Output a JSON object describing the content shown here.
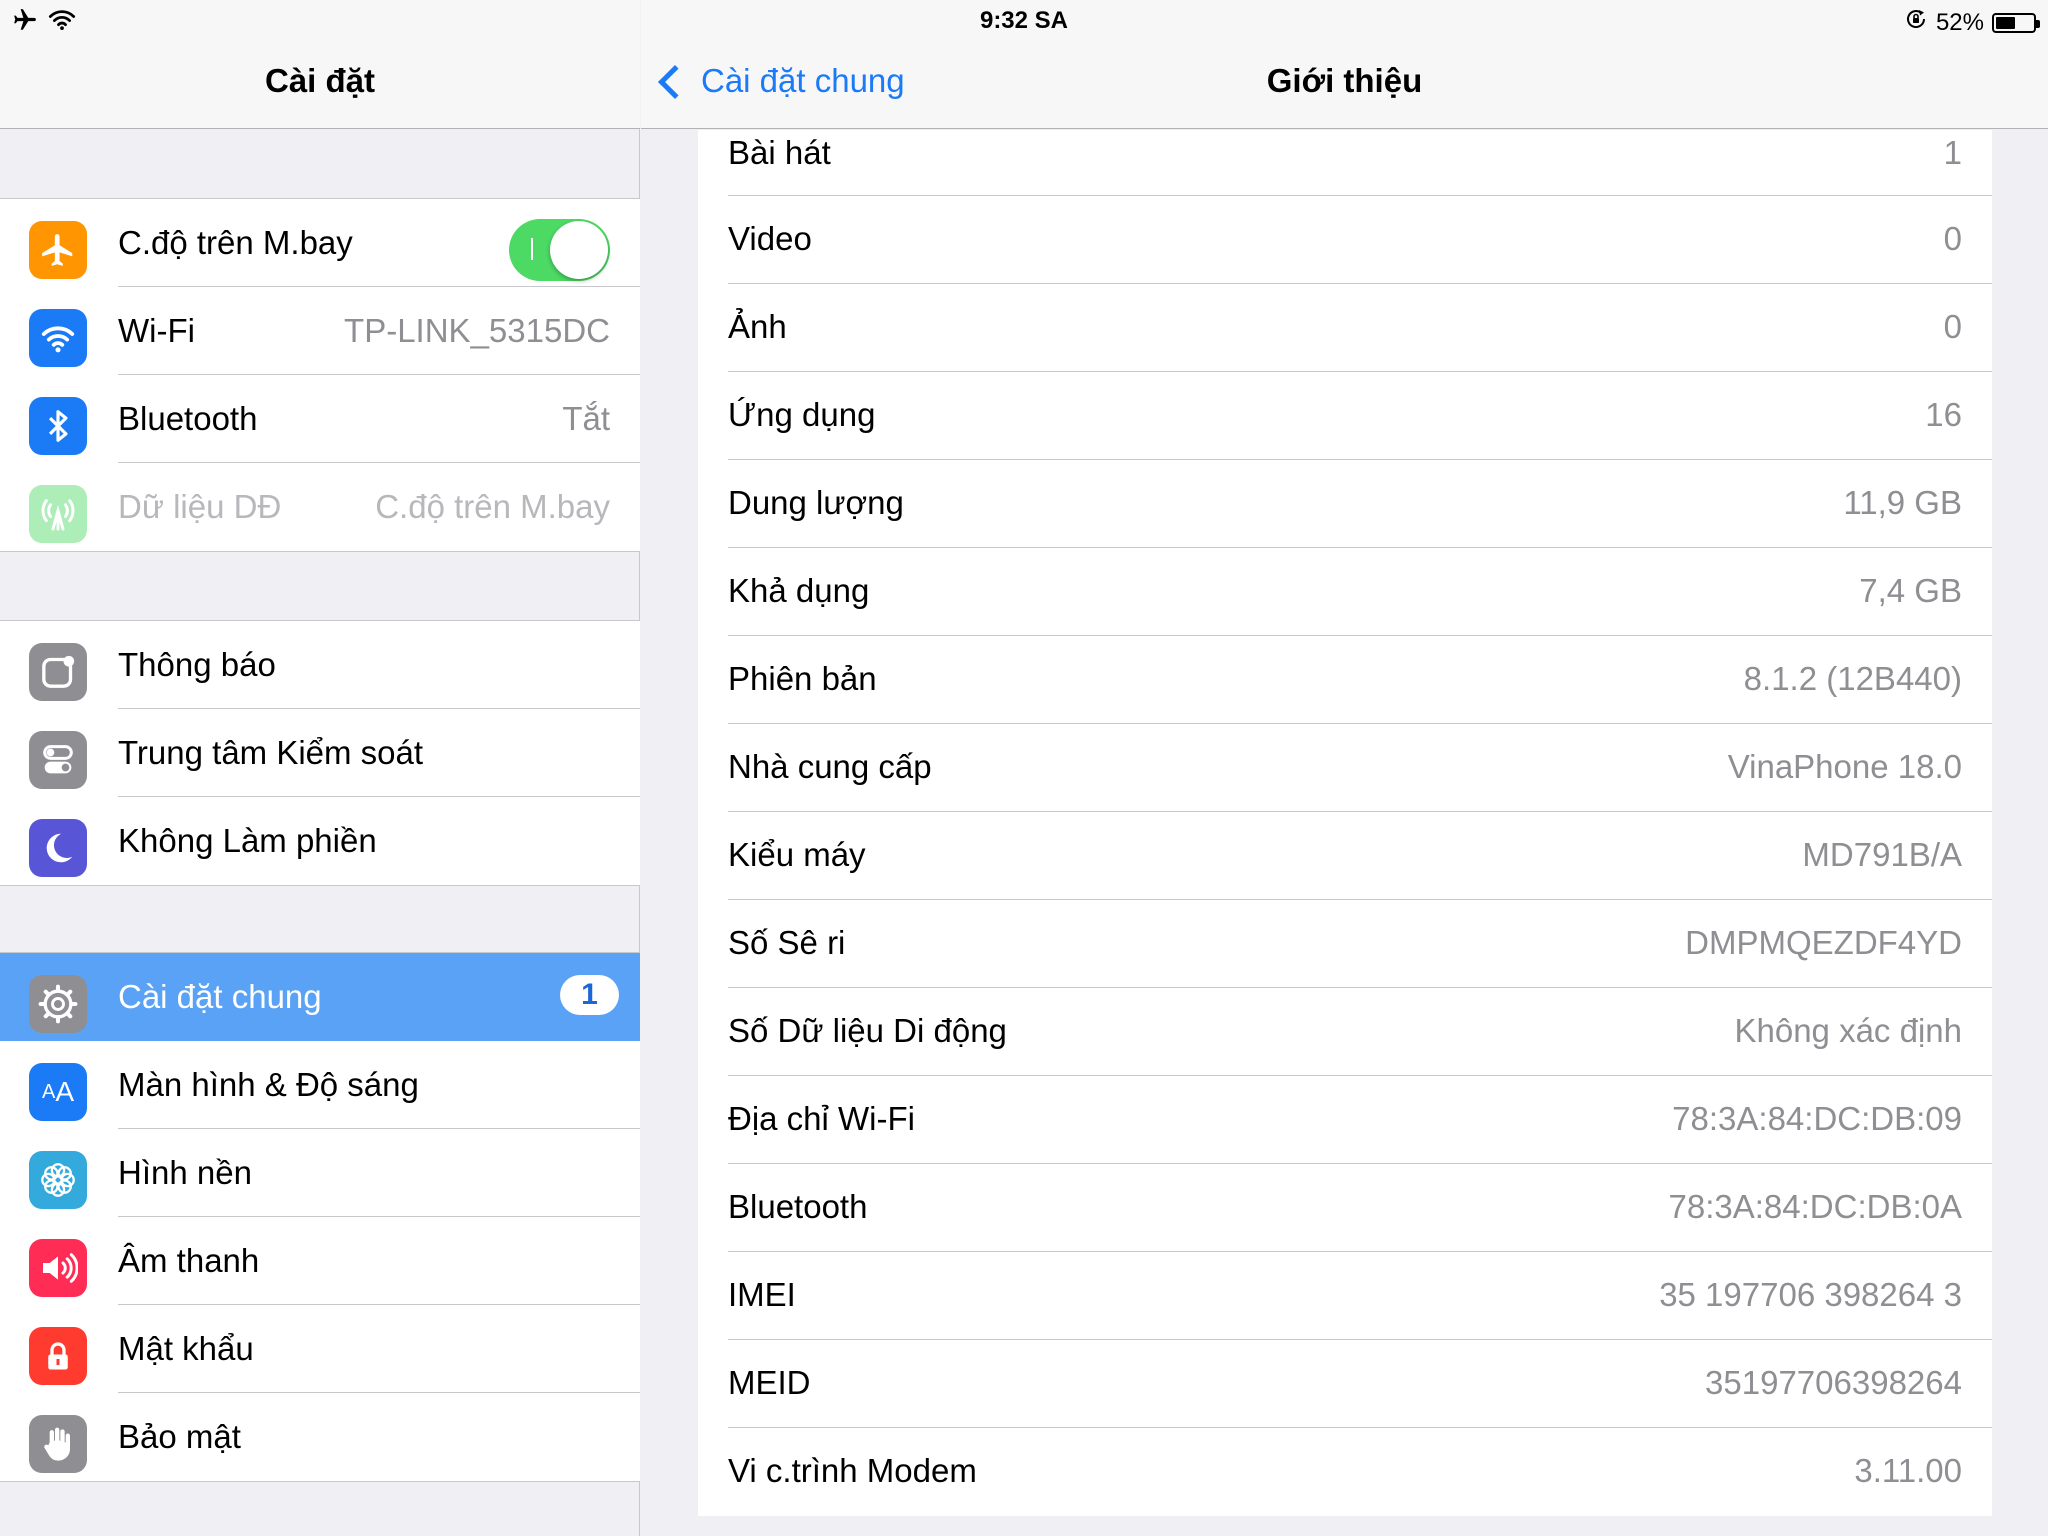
{
  "status_bar": {
    "time": "9:32 SA",
    "battery_text": "52%",
    "battery_level": 0.52,
    "icons": [
      "airplane-icon",
      "wifi-icon",
      "rotation-lock-icon",
      "battery-icon"
    ]
  },
  "master": {
    "title": "Cài đặt",
    "groups": [
      {
        "items": [
          {
            "label": "C.độ trên M.bay",
            "icon": "airplane-icon",
            "color": "#ff9500",
            "toggle_on": true
          },
          {
            "label": "Wi-Fi",
            "value": "TP-LINK_5315DC",
            "icon": "wifi-icon",
            "color": "#1b7bf6"
          },
          {
            "label": "Bluetooth",
            "value": "Tắt",
            "icon": "bluetooth-icon",
            "color": "#1b7bf6"
          },
          {
            "label": "Dữ liệu DĐ",
            "value": "C.độ trên M.bay",
            "icon": "cellular-icon",
            "color": "#4cd964",
            "disabled": true
          }
        ]
      },
      {
        "items": [
          {
            "label": "Thông báo",
            "icon": "notifications-icon",
            "color": "#8e8e93"
          },
          {
            "label": "Trung tâm Kiểm soát",
            "icon": "control-center-icon",
            "color": "#8e8e93"
          },
          {
            "label": "Không Làm phiền",
            "icon": "moon-icon",
            "color": "#5856d6"
          }
        ]
      },
      {
        "items": [
          {
            "label": "Cài đặt chung",
            "icon": "gear-icon",
            "color": "#8e8e93",
            "selected": true,
            "badge": "1"
          },
          {
            "label": "Màn hình & Độ sáng",
            "icon": "display-aa-icon",
            "color": "#1b7bf6"
          },
          {
            "label": "Hình nền",
            "icon": "wallpaper-flower-icon",
            "color": "#34aadc"
          },
          {
            "label": "Âm thanh",
            "icon": "speaker-icon",
            "color": "#ff2d55"
          },
          {
            "label": "Mật khẩu",
            "icon": "lock-icon",
            "color": "#ff3b30"
          },
          {
            "label": "Bảo mật",
            "icon": "hand-icon",
            "color": "#8e8e93"
          }
        ]
      }
    ]
  },
  "detail": {
    "back_label": "Cài đặt chung",
    "title": "Giới thiệu",
    "rows": [
      {
        "key": "Bài hát",
        "value": "1"
      },
      {
        "key": "Video",
        "value": "0"
      },
      {
        "key": "Ảnh",
        "value": "0"
      },
      {
        "key": "Ứng dụng",
        "value": "16"
      },
      {
        "key": "Dung lượng",
        "value": "11,9 GB"
      },
      {
        "key": "Khả dụng",
        "value": "7,4 GB"
      },
      {
        "key": "Phiên bản",
        "value": "8.1.2 (12B440)"
      },
      {
        "key": "Nhà cung cấp",
        "value": "VinaPhone 18.0"
      },
      {
        "key": "Kiểu máy",
        "value": "MD791B/A"
      },
      {
        "key": "Số Sê ri",
        "value": "DMPMQEZDF4YD"
      },
      {
        "key": "Số Dữ liệu Di động",
        "value": "Không xác định"
      },
      {
        "key": "Địa chỉ Wi-Fi",
        "value": "78:3A:84:DC:DB:09"
      },
      {
        "key": "Bluetooth",
        "value": "78:3A:84:DC:DB:0A"
      },
      {
        "key": "IMEI",
        "value": "35 197706 398264 3"
      },
      {
        "key": "MEID",
        "value": "35197706398264"
      },
      {
        "key": "Vi c.trình Modem",
        "value": "3.11.00"
      }
    ]
  }
}
